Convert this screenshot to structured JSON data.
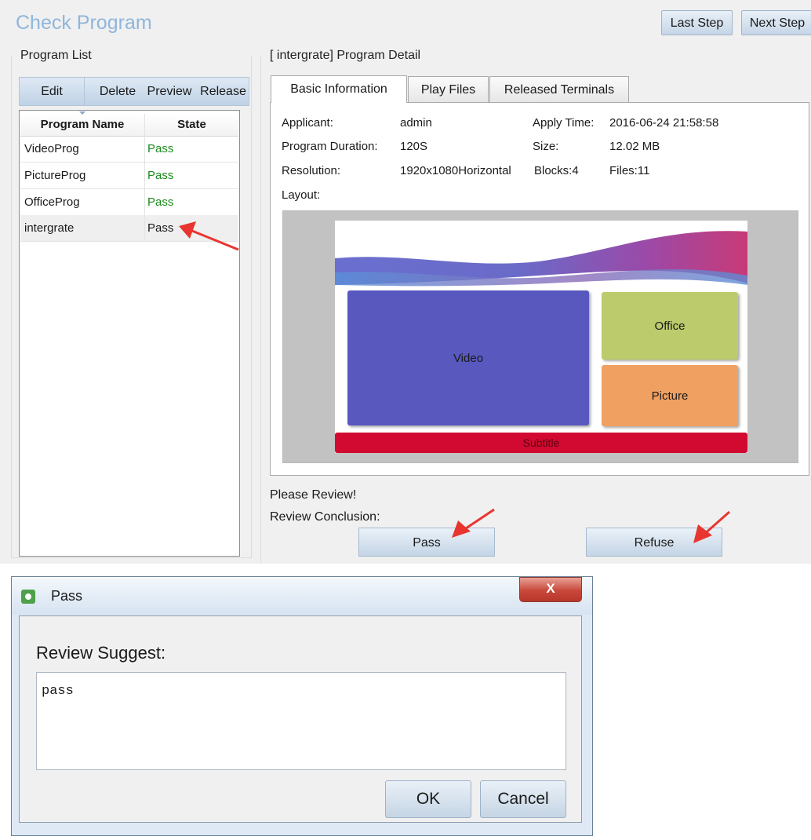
{
  "header": {
    "title": "Check Program",
    "last_step": "Last Step",
    "next_step": "Next Step"
  },
  "program_list": {
    "label": "Program List",
    "toolbar": [
      "Edit",
      "Delete",
      "Preview",
      "Release"
    ],
    "columns": [
      "Program Name",
      "State"
    ],
    "rows": [
      {
        "name": "VideoProg",
        "state": "Pass"
      },
      {
        "name": "PictureProg",
        "state": "Pass"
      },
      {
        "name": "OfficeProg",
        "state": "Pass"
      },
      {
        "name": "intergrate",
        "state": "Pass"
      }
    ],
    "selected_index": 3
  },
  "detail": {
    "label": "[ intergrate] Program Detail",
    "tabs": [
      "Basic Information",
      "Play Files",
      "Released Terminals"
    ],
    "active_tab": 0,
    "applicant_label": "Applicant:",
    "applicant": "admin",
    "apply_time_label": "Apply Time:",
    "apply_time": "2016-06-24 21:58:58",
    "duration_label": "Program Duration:",
    "duration": "120S",
    "size_label": "Size:",
    "size": "12.02 MB",
    "resolution_label": "Resolution:",
    "resolution": "1920x1080Horizontal",
    "blocks": "Blocks:4",
    "files": "Files:11",
    "layout_label": "Layout:",
    "layout_blocks": {
      "video": "Video",
      "office": "Office",
      "picture": "Picture",
      "subtitle": "Subtitle"
    }
  },
  "review": {
    "prompt": "Please Review!",
    "conclusion_label": "Review Conclusion:",
    "pass_button": "Pass",
    "refuse_button": "Refuse"
  },
  "dialog": {
    "title": "Pass",
    "close_glyph": "X",
    "suggest_label": "Review Suggest:",
    "suggest_value": "pass",
    "ok_button": "OK",
    "cancel_button": "Cancel"
  },
  "colors": {
    "state_green": "#1c8a1c",
    "video_block": "#5858bf",
    "office_block": "#bccb6b",
    "picture_block": "#f0a060",
    "subtitle_bar": "#d20a32",
    "arrow": "#e8352f"
  }
}
